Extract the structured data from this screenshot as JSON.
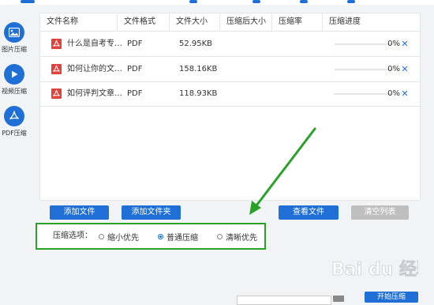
{
  "colors": {
    "accent": "#1f6fd6",
    "highlight": "#2aa22a",
    "pdf_red": "#e0433a",
    "clear_button": "#bfbfbf"
  },
  "sidebar": {
    "items": [
      {
        "label": "图片压缩",
        "icon": "image-icon"
      },
      {
        "label": "视频压缩",
        "icon": "play-icon"
      },
      {
        "label": "PDF压缩",
        "icon": "pdf-icon"
      }
    ]
  },
  "table": {
    "headers": [
      "文件名称",
      "文件格式",
      "文件大小",
      "压缩后大小",
      "压缩率",
      "压缩进度"
    ],
    "rows": [
      {
        "name": "什么是自考专…",
        "format": "PDF",
        "size": "52.95KB",
        "compressed_size": "",
        "ratio": "",
        "progress": "0%"
      },
      {
        "name": "如何让你的文…",
        "format": "PDF",
        "size": "158.16KB",
        "compressed_size": "",
        "ratio": "",
        "progress": "0%"
      },
      {
        "name": "如何评判文章…",
        "format": "PDF",
        "size": "118.93KB",
        "compressed_size": "",
        "ratio": "",
        "progress": "0%"
      }
    ],
    "remove_symbol": "✕"
  },
  "actions": {
    "add_file": "添加文件",
    "add_folder": "添加文件夹",
    "view_files": "查看文件",
    "clear_list": "清空列表"
  },
  "compress_options": {
    "label": "压缩选项：",
    "options": [
      "缩小优先",
      "普通压缩",
      "清晰优先"
    ],
    "selected": "普通压缩"
  },
  "bottom": {
    "start_button": "开始压缩"
  },
  "watermark": "Bai du 经验"
}
